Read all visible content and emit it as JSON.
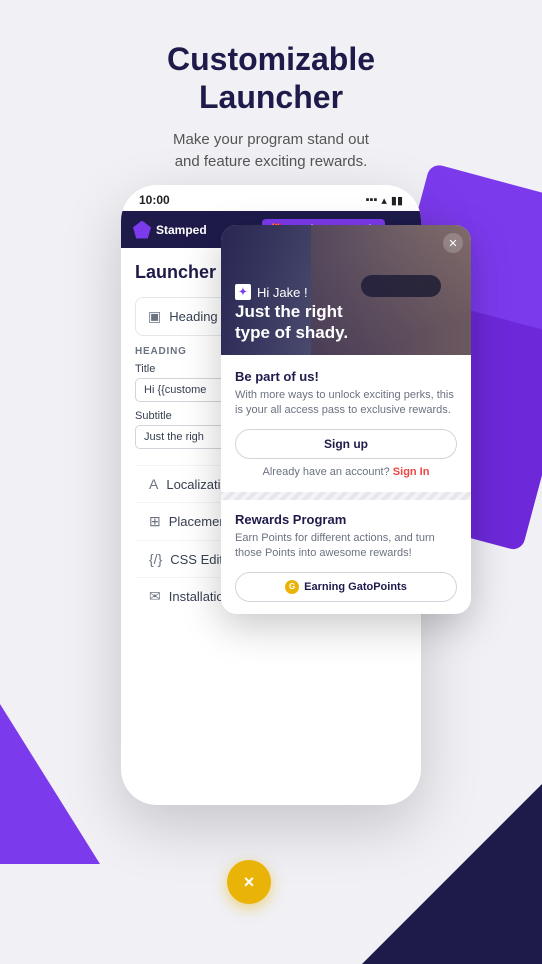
{
  "header": {
    "title_line1": "Customizable",
    "title_line2": "Launcher",
    "subtitle": "Make your program stand out\nand feature exciting rewards."
  },
  "phone": {
    "status_time": "10:00",
    "nav": {
      "logo": "Stamped",
      "loyalty_btn": "Loyalty & Rewards"
    },
    "launcher_title": "Launcher",
    "heading_section": {
      "label": "Heading",
      "sub_label": "HEADING",
      "title_field_label": "Title",
      "title_field_value": "Hi {{custome",
      "subtitle_field_label": "Subtitle",
      "subtitle_field_value": "Just the righ"
    },
    "menu_items": [
      {
        "icon": "A",
        "label": "Localization"
      },
      {
        "icon": "⊞",
        "label": "Placement"
      },
      {
        "icon": "{/}",
        "label": "CSS Editor"
      },
      {
        "icon": "✉",
        "label": "Installation"
      }
    ]
  },
  "popup": {
    "greeting": "Hi Jake !",
    "tagline_line1": "Just the right",
    "tagline_line2": "type of shady.",
    "body_title": "Be part of us!",
    "body_desc": "With more ways to unlock exciting perks, this is your all access pass to exclusive rewards.",
    "signup_btn": "Sign up",
    "signin_text": "Already have an account?",
    "signin_link": "Sign In",
    "rewards_title": "Rewards Program",
    "rewards_desc": "Earn Points for different actions, and turn those Points into awesome rewards!",
    "earning_btn": "Earning GatoPoints"
  },
  "close_fab": "×"
}
